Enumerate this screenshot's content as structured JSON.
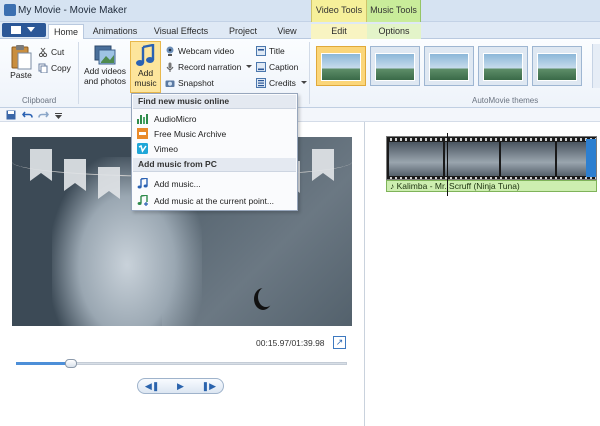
{
  "window": {
    "title": "My Movie - Movie Maker"
  },
  "contextual": {
    "video_tools": "Video Tools",
    "music_tools": "Music Tools"
  },
  "tabs": [
    "Home",
    "Animations",
    "Visual Effects",
    "Project",
    "View",
    "Edit",
    "Options"
  ],
  "ribbon": {
    "clipboard": {
      "paste": "Paste",
      "cut": "Cut",
      "copy": "Copy",
      "group": "Clipboard"
    },
    "add_videos": "Add videos and photos",
    "add_music": "Add music",
    "webcam": "Webcam video",
    "record": "Record narration",
    "snapshot": "Snapshot",
    "title": "Title",
    "caption": "Caption",
    "credits": "Credits",
    "themes_group": "AutoMovie themes"
  },
  "dropdown": {
    "section_online": "Find new music online",
    "online_items": [
      "AudioMicro",
      "Free Music Archive",
      "Vimeo"
    ],
    "section_pc": "Add music from PC",
    "pc_items": [
      "Add music...",
      "Add music at the current point..."
    ]
  },
  "player": {
    "time": "00:15.97/01:39.98",
    "progress": 0.165
  },
  "storyboard": {
    "music_track": "Kalimba - Mr. Scruff (Ninja Tuna)"
  },
  "colors": {
    "accent": "#2b5797",
    "music_highlight": "#fde59c",
    "music_track": "#cdeeb0"
  }
}
